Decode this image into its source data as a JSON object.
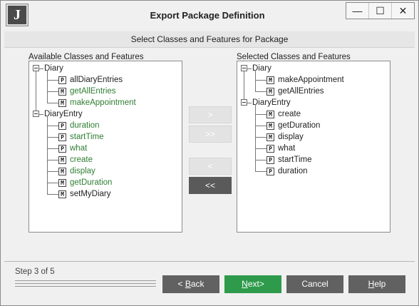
{
  "window": {
    "logo_letter": "J",
    "title": "Export Package Definition",
    "controls": {
      "minimize": "—",
      "maximize": "☐",
      "close": "✕"
    }
  },
  "banner": "Select Classes and Features for Package",
  "available": {
    "label": "Available Classes and Features",
    "nodes": [
      {
        "kind": "class",
        "label": "Diary",
        "color": "dark"
      },
      {
        "kind": "P",
        "label": "allDiaryEntries",
        "color": "dark"
      },
      {
        "kind": "M",
        "label": "getAllEntries",
        "color": "green"
      },
      {
        "kind": "M",
        "label": "makeAppointment",
        "color": "green"
      },
      {
        "kind": "class",
        "label": "DiaryEntry",
        "color": "dark"
      },
      {
        "kind": "P",
        "label": "duration",
        "color": "green"
      },
      {
        "kind": "P",
        "label": "startTime",
        "color": "green"
      },
      {
        "kind": "P",
        "label": "what",
        "color": "green"
      },
      {
        "kind": "M",
        "label": "create",
        "color": "green"
      },
      {
        "kind": "M",
        "label": "display",
        "color": "green"
      },
      {
        "kind": "M",
        "label": "getDuration",
        "color": "green"
      },
      {
        "kind": "M",
        "label": "setMyDiary",
        "color": "dark"
      }
    ]
  },
  "selected": {
    "label": "Selected Classes and Features",
    "nodes": [
      {
        "kind": "class",
        "label": "Diary",
        "color": "dark"
      },
      {
        "kind": "M",
        "label": "makeAppointment",
        "color": "dark"
      },
      {
        "kind": "M",
        "label": "getAllEntries",
        "color": "dark"
      },
      {
        "kind": "class",
        "label": "DiaryEntry",
        "color": "dark"
      },
      {
        "kind": "M",
        "label": "create",
        "color": "dark"
      },
      {
        "kind": "M",
        "label": "getDuration",
        "color": "dark"
      },
      {
        "kind": "M",
        "label": "display",
        "color": "dark"
      },
      {
        "kind": "P",
        "label": "what",
        "color": "dark"
      },
      {
        "kind": "P",
        "label": "startTime",
        "color": "dark"
      },
      {
        "kind": "P",
        "label": "duration",
        "color": "dark"
      }
    ]
  },
  "move_buttons": {
    "add": ">",
    "add_all": ">>",
    "remove": "<",
    "remove_all": "<<"
  },
  "footer": {
    "step_text": "Step 3 of 5",
    "back": {
      "prefix": "< ",
      "mnemonic": "B",
      "rest": "ack"
    },
    "next": {
      "prefix": "",
      "mnemonic": "N",
      "rest": "ext>"
    },
    "cancel": "Cancel",
    "help": {
      "prefix": "",
      "mnemonic": "H",
      "rest": "elp"
    }
  },
  "colors": {
    "green": "#2e7d32",
    "primary_button": "#2e9a4b",
    "dark_button": "#616161"
  }
}
